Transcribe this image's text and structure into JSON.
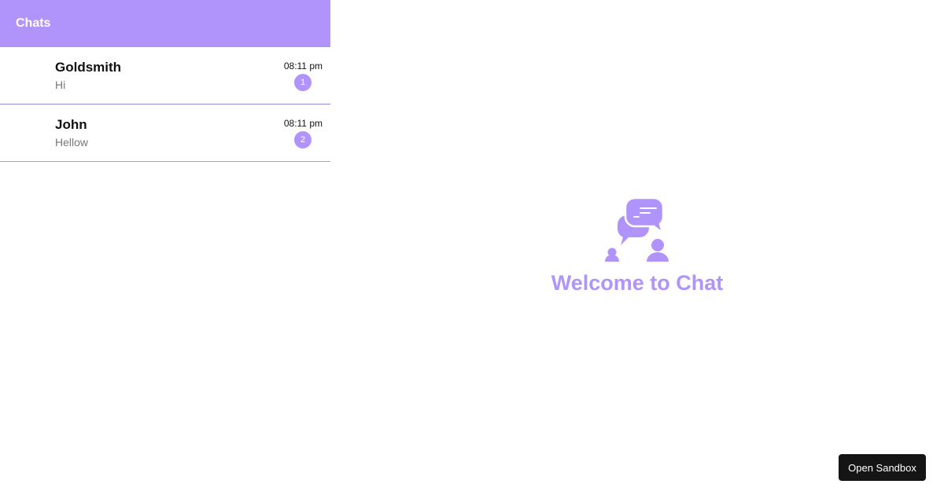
{
  "sidebar": {
    "title": "Chats",
    "chats": [
      {
        "name": "Goldsmith",
        "message": "Hi",
        "time": "08:11 pm",
        "unread": "1"
      },
      {
        "name": "John",
        "message": "Hellow",
        "time": "08:11 pm",
        "unread": "2"
      }
    ]
  },
  "welcome": {
    "icon": "chat-bubbles-people-icon",
    "title": "Welcome to Chat"
  },
  "sandbox": {
    "label": "Open Sandbox"
  },
  "colors": {
    "accent": "#b093fb",
    "sandbox_button": "#151515"
  }
}
